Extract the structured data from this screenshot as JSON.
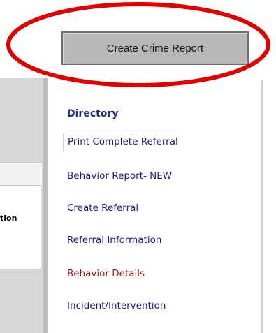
{
  "toolbar": {
    "create_crime_report_label": "Create Crime Report"
  },
  "left_panel": {
    "truncated_label": "tion"
  },
  "directory": {
    "heading": "Directory",
    "items": [
      {
        "label": "Print Complete Referral",
        "color": "#1a1a8c",
        "selected": true
      },
      {
        "label": "Behavior Report- NEW",
        "color": "#1a1a8c",
        "selected": false
      },
      {
        "label": "Create Referral",
        "color": "#1a1a8c",
        "selected": false
      },
      {
        "label": "Referral Information",
        "color": "#1a1a8c",
        "selected": false
      },
      {
        "label": "Behavior Details",
        "color": "#9a1a1a",
        "selected": false
      },
      {
        "label": "Incident/Intervention",
        "color": "#1a1a8c",
        "selected": false
      }
    ]
  },
  "colors": {
    "highlight": "#e00000",
    "link": "#1a1a8c",
    "active_link": "#9a1a1a",
    "heading": "#1a2b8a"
  }
}
